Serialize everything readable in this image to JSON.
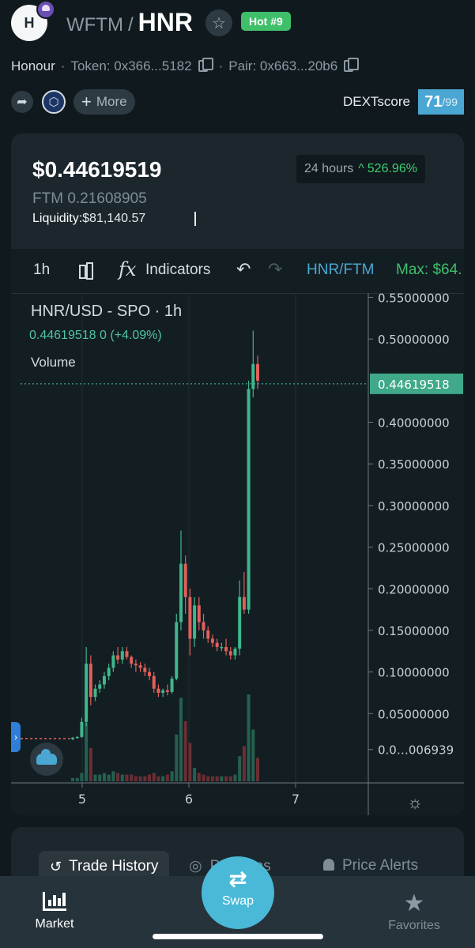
{
  "header": {
    "avatar_letter": "H",
    "quote_token": "WFTM",
    "separator": "/",
    "base_token": "HNR",
    "hot_badge": "Hot #9"
  },
  "meta": {
    "name": "Honour",
    "token_label": "Token: 0x366...5182",
    "pair_label": "Pair: 0x663...20b6"
  },
  "actions": {
    "more_label": "More",
    "dext_label": "DEXTscore",
    "dext_score": "71",
    "dext_max": "/99"
  },
  "price_panel": {
    "price_usd": "$0.44619519",
    "price_ftm": "FTM 0.21608905",
    "liquidity_label": "Liquidity:",
    "liquidity_value": "$81,140.57",
    "change_period": "24 hours",
    "change_pct": "526.96%"
  },
  "chart_toolbar": {
    "interval": "1h",
    "indicators_label": "Indicators",
    "symbol": "HNR/FTM",
    "max_label": "Max: $64."
  },
  "chart_legend": {
    "title": "HNR/USD - SPO · 1h",
    "values": "0.44619518  0 (+4.09%)",
    "volume_label": "Volume"
  },
  "chart_data": {
    "type": "candlestick",
    "x_ticks": [
      "5",
      "6",
      "7"
    ],
    "y_ticks": [
      "0.55000000",
      "0.50000000",
      "0.40000000",
      "0.35000000",
      "0.30000000",
      "0.25000000",
      "0.20000000",
      "0.15000000",
      "0.10000000",
      "0.05000000",
      "0.0…006939"
    ],
    "last_price_label": "0.44619518",
    "ylim": [
      0,
      0.56
    ],
    "up_color": "#3fb68b",
    "down_color": "#e0605a",
    "candles": [
      [
        0.02,
        0.022,
        0.018,
        0.021
      ],
      [
        0.021,
        0.023,
        0.02,
        0.022
      ],
      [
        0.022,
        0.045,
        0.021,
        0.04
      ],
      [
        0.04,
        0.13,
        0.035,
        0.11
      ],
      [
        0.11,
        0.12,
        0.06,
        0.07
      ],
      [
        0.07,
        0.085,
        0.065,
        0.08
      ],
      [
        0.08,
        0.09,
        0.075,
        0.085
      ],
      [
        0.085,
        0.1,
        0.08,
        0.095
      ],
      [
        0.095,
        0.11,
        0.09,
        0.105
      ],
      [
        0.105,
        0.125,
        0.1,
        0.12
      ],
      [
        0.12,
        0.13,
        0.11,
        0.115
      ],
      [
        0.115,
        0.13,
        0.11,
        0.125
      ],
      [
        0.125,
        0.13,
        0.115,
        0.118
      ],
      [
        0.118,
        0.12,
        0.105,
        0.11
      ],
      [
        0.11,
        0.115,
        0.1,
        0.108
      ],
      [
        0.108,
        0.112,
        0.1,
        0.105
      ],
      [
        0.105,
        0.11,
        0.095,
        0.1
      ],
      [
        0.1,
        0.105,
        0.09,
        0.095
      ],
      [
        0.095,
        0.1,
        0.075,
        0.08
      ],
      [
        0.08,
        0.085,
        0.07,
        0.075
      ],
      [
        0.075,
        0.08,
        0.07,
        0.078
      ],
      [
        0.078,
        0.085,
        0.072,
        0.076
      ],
      [
        0.076,
        0.095,
        0.074,
        0.092
      ],
      [
        0.092,
        0.17,
        0.09,
        0.16
      ],
      [
        0.16,
        0.27,
        0.15,
        0.23
      ],
      [
        0.23,
        0.24,
        0.17,
        0.19
      ],
      [
        0.19,
        0.2,
        0.12,
        0.14
      ],
      [
        0.14,
        0.19,
        0.13,
        0.18
      ],
      [
        0.18,
        0.19,
        0.15,
        0.16
      ],
      [
        0.16,
        0.17,
        0.14,
        0.15
      ],
      [
        0.15,
        0.155,
        0.135,
        0.14
      ],
      [
        0.14,
        0.145,
        0.13,
        0.135
      ],
      [
        0.135,
        0.14,
        0.125,
        0.13
      ],
      [
        0.13,
        0.135,
        0.125,
        0.13
      ],
      [
        0.13,
        0.14,
        0.12,
        0.125
      ],
      [
        0.125,
        0.13,
        0.115,
        0.12
      ],
      [
        0.12,
        0.13,
        0.115,
        0.128
      ],
      [
        0.128,
        0.21,
        0.12,
        0.19
      ],
      [
        0.19,
        0.22,
        0.17,
        0.175
      ],
      [
        0.175,
        0.45,
        0.17,
        0.44
      ],
      [
        0.44,
        0.51,
        0.43,
        0.47
      ],
      [
        0.47,
        0.48,
        0.44,
        0.45
      ]
    ],
    "volumes": [
      0.2,
      0.2,
      0.5,
      3.5,
      2.0,
      0.4,
      0.4,
      0.5,
      0.4,
      0.6,
      0.5,
      0.4,
      0.4,
      0.4,
      0.3,
      0.3,
      0.3,
      0.4,
      0.5,
      0.3,
      0.3,
      0.4,
      0.6,
      2.8,
      5.0,
      3.6,
      2.3,
      0.8,
      0.5,
      0.4,
      0.3,
      0.3,
      0.3,
      0.3,
      0.3,
      0.3,
      0.4,
      1.5,
      2.1,
      5.2,
      3.1,
      1.4
    ]
  },
  "bottom_tabs": {
    "trade_history": "Trade History",
    "positions": "Positions",
    "price_alerts": "Price Alerts"
  },
  "bottom_nav": {
    "market": "Market",
    "swap": "Swap",
    "favorites": "Favorites"
  }
}
